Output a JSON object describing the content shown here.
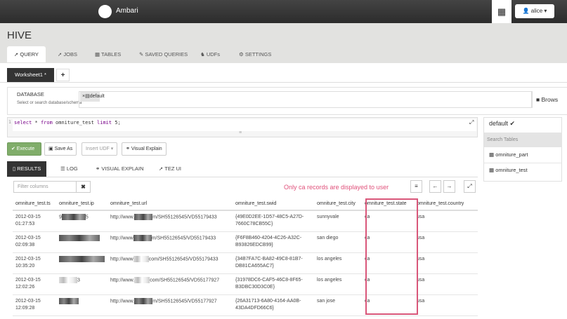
{
  "topbar": {
    "brand": "Ambari",
    "user": "alice ▾",
    "grid_icon": "apps-grid-icon",
    "user_icon": "user-icon"
  },
  "header": {
    "title": "HIVE",
    "tabs": [
      {
        "label": "QUERY",
        "icon": "paper-plane-icon"
      },
      {
        "label": "JOBS",
        "icon": "paper-plane-icon"
      },
      {
        "label": "TABLES",
        "icon": "table-icon"
      },
      {
        "label": "SAVED QUERIES",
        "icon": "paperclip-icon"
      },
      {
        "label": "UDFs",
        "icon": "puzzle-icon"
      },
      {
        "label": "SETTINGS",
        "icon": "gear-icon"
      }
    ]
  },
  "worksheet": {
    "tab": "Worksheet1 *",
    "add": "+"
  },
  "database": {
    "label": "DATABASE",
    "hint": "Select or search database/schema",
    "selected": "default",
    "browse": "Brows"
  },
  "editor": {
    "line": "1",
    "keyword1": "select",
    "rest1": " * ",
    "keyword2": "from",
    "rest2": " omniture_test ",
    "keyword3": "limit",
    "rest3": " 5;"
  },
  "actions": {
    "execute": "✔ Execute",
    "save_as": "Save As",
    "insert_udf": "Insert UDF ▾",
    "visual_explain": "Visual Explain"
  },
  "side": {
    "db": "default ✔",
    "search_placeholder": "Search Tables",
    "tables": [
      "omniture_part",
      "omniture_test"
    ]
  },
  "result_tabs": [
    "RESULTS",
    "LOG",
    "VISUAL EXPLAIN",
    "TEZ UI"
  ],
  "filter": {
    "placeholder": "Filter columns",
    "clear": "✖"
  },
  "notice": "Only ca records are displayed to user",
  "table": {
    "columns": [
      "omniture_test.ts",
      "omniture_test.ip",
      "omniture_test.url",
      "omniture_test.swid",
      "omniture_test.city",
      "omniture_test.state",
      "omniture_test.country"
    ],
    "rows": [
      {
        "ts": "2012-03-15 01:27:53",
        "ip_pre": "9",
        "ip_post": "5",
        "url_pre": "http://www.",
        "url_post": "m/SH55126545/VD55179433",
        "swid": "{49E0D2EE-1D57-48C5-A27D-7660C78CB55C}",
        "city": "sunnyvale",
        "state": "ca",
        "country": "usa"
      },
      {
        "ts": "2012-03-15 02:09:38",
        "ip_pre": "",
        "ip_post": "",
        "url_pre": "http://www",
        "url_post": "m/SH55126545/VD55179433",
        "swid": "{F6F8B460-4204-4C26-A32C-B93826EDCB99}",
        "city": "san diego",
        "state": "ca",
        "country": "usa"
      },
      {
        "ts": "2012-03-15 10:35:20",
        "ip_pre": "",
        "ip_post": "",
        "url_pre": "http://www",
        "url_post": "com/SH55126545/VD55179433",
        "swid": "{34B7FA7C-BA82-49C8-81B7-DB81CA655AC7}",
        "city": "los angeles",
        "state": "ca",
        "country": "usa"
      },
      {
        "ts": "2012-03-15 12:02:26",
        "ip_pre": "",
        "ip_post": "3",
        "url_pre": "http://www.",
        "url_post": "com/SH55126545/VD55177927",
        "swid": "{31978DC6-CAF5-46C8-8F65-B3DBC30D3C0E}",
        "city": "los angeles",
        "state": "ca",
        "country": "usa"
      },
      {
        "ts": "2012-03-15 12:09:28",
        "ip_pre": "",
        "ip_post": "",
        "url_pre": "http://www.",
        "url_post": "m/SH55126545/VD55177927",
        "swid": "{26A31713-6A80-4164-AA0B-43DA4DFD66C6}",
        "city": "san jose",
        "state": "ca",
        "country": "usa"
      }
    ]
  },
  "colors": {
    "highlight": "#d9577a",
    "execute": "#80ad6a",
    "topbar": "#333333"
  }
}
